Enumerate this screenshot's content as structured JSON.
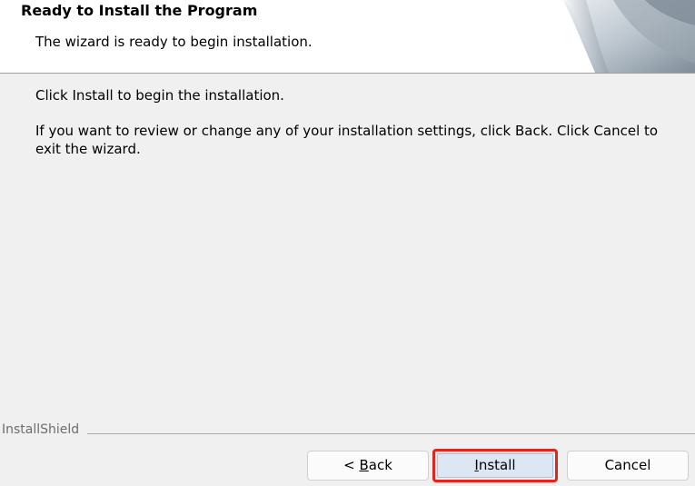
{
  "header": {
    "title": "Ready to Install the Program",
    "subtitle": "The wizard is ready to begin installation."
  },
  "content": {
    "line1": "Click Install to begin the installation.",
    "line2": "If you want to review or change any of your installation settings, click Back. Click Cancel to exit the wizard."
  },
  "footer": {
    "brand": "InstallShield"
  },
  "buttons": {
    "back": {
      "prefix": "< ",
      "mnemonic": "B",
      "rest": "ack"
    },
    "install": {
      "mnemonic": "I",
      "rest": "nstall",
      "highlight_color": "#e0241f"
    },
    "cancel": {
      "label": "Cancel"
    }
  }
}
